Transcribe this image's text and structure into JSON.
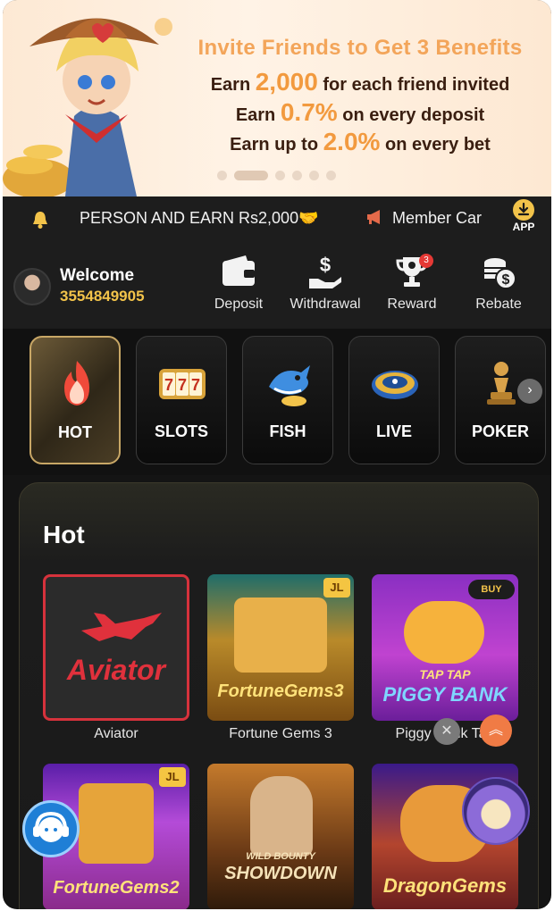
{
  "banner": {
    "title": "Invite Friends to Get 3 Benefits",
    "line1_prefix": "Earn ",
    "line1_value": "2,000",
    "line1_suffix": " for each friend invited",
    "line2_prefix": "Earn ",
    "line2_value": "0.7%",
    "line2_suffix": " on every deposit",
    "line3_prefix": "Earn up to ",
    "line3_value": "2.0%",
    "line3_suffix": " on every bet",
    "slide_count": 6,
    "active_slide": 2
  },
  "marquee": {
    "icon": "bell-icon",
    "text1": "PERSON AND EARN Rs2,000🤝",
    "text2": "Member Car",
    "app_label": "APP"
  },
  "user": {
    "welcome": "Welcome",
    "id": "3554849905"
  },
  "actions": [
    {
      "label": "Deposit",
      "icon": "wallet-icon"
    },
    {
      "label": "Withdrawal",
      "icon": "money-hand-icon"
    },
    {
      "label": "Reward",
      "icon": "trophy-icon",
      "badge": "3"
    },
    {
      "label": "Rebate",
      "icon": "coins-icon"
    }
  ],
  "categories": [
    {
      "label": "HOT",
      "icon": "flame-icon",
      "active": true
    },
    {
      "label": "SLOTS",
      "icon": "slots-777-icon"
    },
    {
      "label": "FISH",
      "icon": "shark-icon"
    },
    {
      "label": "LIVE",
      "icon": "roulette-icon"
    },
    {
      "label": "POKER",
      "icon": "chess-pawn-icon"
    }
  ],
  "hot": {
    "title": "Hot",
    "games": [
      {
        "name": "Aviator",
        "art": "Aviator"
      },
      {
        "name": "Fortune Gems 3",
        "art": "FortuneGems3",
        "tag": "JL"
      },
      {
        "name": "Piggy Bank Tap",
        "art": "PIGGY BANK",
        "art_top": "TAP TAP",
        "tag": "BUY"
      },
      {
        "name": "",
        "art": "FortuneGems2",
        "tag": "JL"
      },
      {
        "name": "",
        "art": "SHOWDOWN",
        "art_top": "WILD BOUNTY"
      },
      {
        "name": "",
        "art": "DragonGems"
      }
    ]
  },
  "colors": {
    "accent_gold": "#f2c34a",
    "banner_orange": "#f29a3f",
    "page_bg": "#141414"
  }
}
